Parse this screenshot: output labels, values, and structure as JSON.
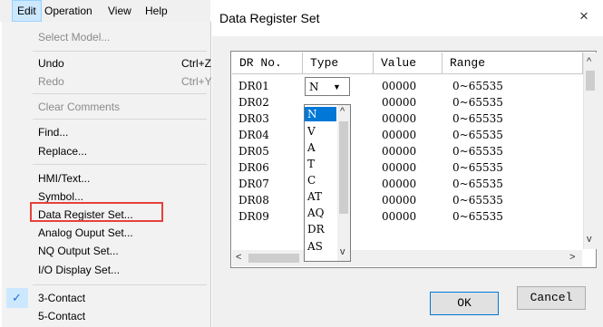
{
  "menubar": {
    "items": [
      "Edit",
      "Operation",
      "View",
      "Help"
    ]
  },
  "menu": {
    "select_model": "Select Model...",
    "undo": "Undo",
    "undo_shortcut": "Ctrl+Z",
    "redo": "Redo",
    "redo_shortcut": "Ctrl+Y",
    "clear_comments": "Clear Comments",
    "find": "Find...",
    "replace": "Replace...",
    "hmi_text": "HMI/Text...",
    "symbol": "Symbol...",
    "data_register_set": "Data Register Set...",
    "analog_output_set": "Analog Ouput Set...",
    "nq_output_set": "NQ Output Set...",
    "io_display_set": "I/O Display Set...",
    "contact3": "3-Contact",
    "contact5": "5-Contact"
  },
  "dialog": {
    "title": "Data Register Set",
    "close_glyph": "×",
    "columns": [
      "DR No.",
      "Type",
      "Value",
      "Range"
    ],
    "rows": [
      {
        "dr": "DR01",
        "value": "00000",
        "range": "0~65535"
      },
      {
        "dr": "DR02",
        "value": "00000",
        "range": "0~65535"
      },
      {
        "dr": "DR03",
        "value": "00000",
        "range": "0~65535"
      },
      {
        "dr": "DR04",
        "value": "00000",
        "range": "0~65535"
      },
      {
        "dr": "DR05",
        "value": "00000",
        "range": "0~65535"
      },
      {
        "dr": "DR06",
        "value": "00000",
        "range": "0~65535"
      },
      {
        "dr": "DR07",
        "value": "00000",
        "range": "0~65535"
      },
      {
        "dr": "DR08",
        "value": "00000",
        "range": "0~65535"
      },
      {
        "dr": "DR09",
        "value": "00000",
        "range": "0~65535"
      }
    ],
    "type_value": "N",
    "type_options": [
      "N",
      "V",
      "A",
      "T",
      "C",
      "AT",
      "AQ",
      "DR",
      "AS"
    ],
    "ok_label": "OK",
    "cancel_label": "Cancel"
  },
  "colors": {
    "highlight_border": "#e8413a",
    "selection": "#0078d7",
    "menu_hover": "#cce8ff"
  }
}
